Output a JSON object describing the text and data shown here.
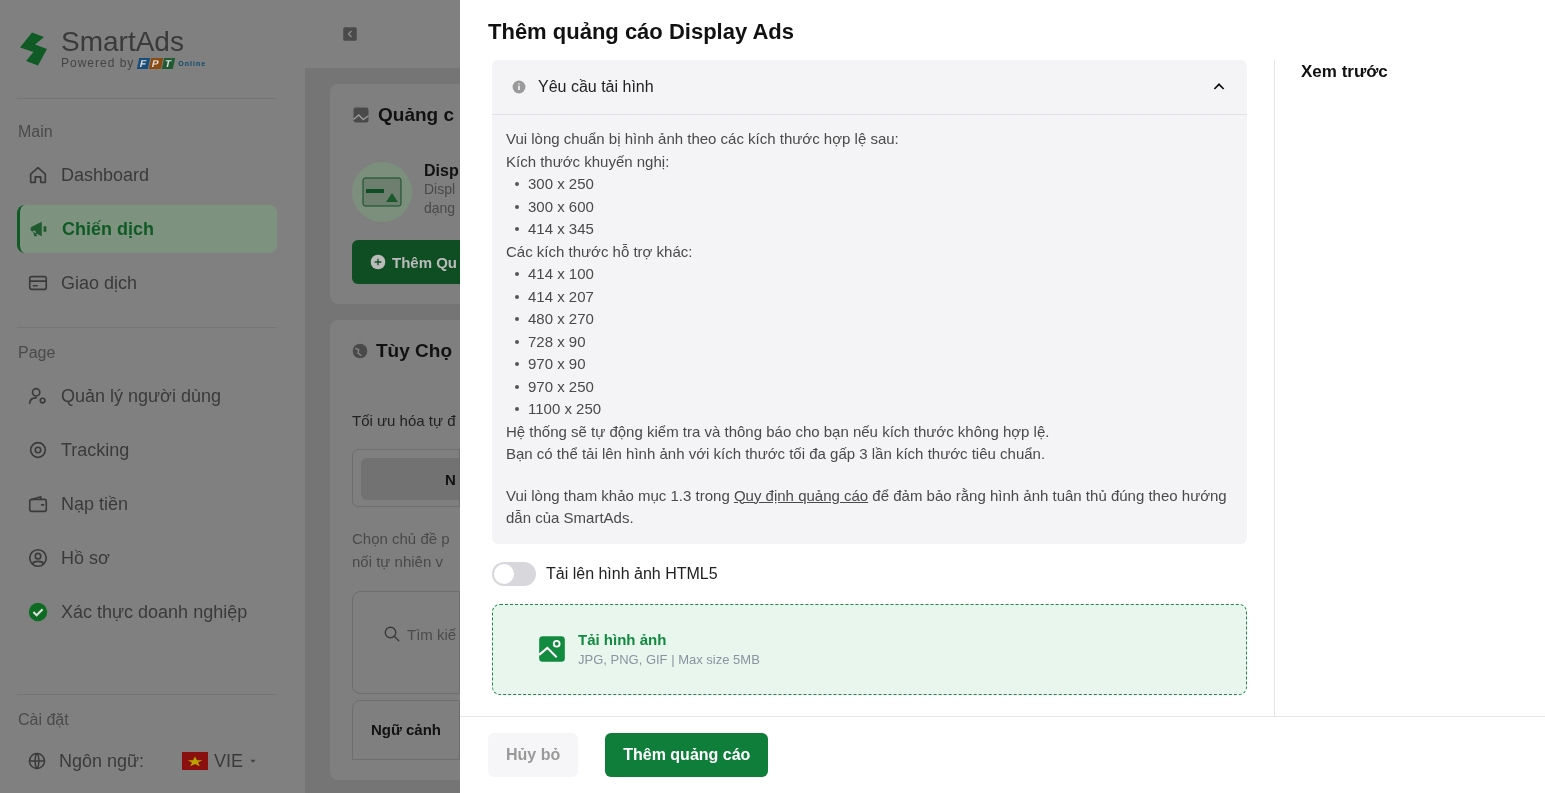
{
  "sidebar": {
    "brand": "SmartAds",
    "powered_by": "Powered by",
    "partner_letters": [
      "F",
      "P",
      "T"
    ],
    "partner_suffix": "Online",
    "sections": [
      {
        "label": "Main",
        "items": [
          {
            "label": "Dashboard",
            "selected": false
          },
          {
            "label": "Chiến dịch",
            "selected": true
          },
          {
            "label": "Giao dịch",
            "selected": false
          }
        ]
      },
      {
        "label": "Page",
        "items": [
          {
            "label": "Quản lý người dùng",
            "selected": false
          },
          {
            "label": "Tracking",
            "selected": false
          },
          {
            "label": "Nạp tiền",
            "selected": false
          },
          {
            "label": "Hồ sơ",
            "selected": false
          },
          {
            "label": "Xác thực doanh nghiệp",
            "selected": false
          }
        ]
      }
    ],
    "settings": {
      "label": "Cài đặt",
      "language_label": "Ngôn ngữ:",
      "language_value": "VIE"
    }
  },
  "main": {
    "ads_card": {
      "title": "Quảng c",
      "item_title": "Disp",
      "item_desc": [
        "Displ",
        "dạng"
      ],
      "add_button": "Thêm Qu"
    },
    "options_card": {
      "title": "Tùy Chọ",
      "subtitle": "Tối ưu hóa tự đ",
      "tab": "N",
      "desc": [
        "Chọn chủ đề p",
        "nối tự nhiên v"
      ],
      "search_placeholder": "Tìm kiế",
      "context_title": "Ngữ cảnh"
    }
  },
  "drawer": {
    "title": "Thêm quảng cáo Display Ads",
    "requirements": {
      "title": "Yêu cầu tải hình",
      "expanded": true,
      "intro": "Vui lòng chuẩn bị hình ảnh theo các kích thước hợp lệ sau:",
      "recommended_label": "Kích thước khuyến nghị:",
      "recommended": [
        "300 x 250",
        "300 x 600",
        "414 x 345"
      ],
      "other_label": "Các kích thước hỗ trợ khác:",
      "others": [
        "414 x 100",
        "414 x 207",
        "480 x 270",
        "728 x 90",
        "970 x 90",
        "970 x 250",
        "1100 x 250"
      ],
      "notes": [
        "Hệ thống sẽ tự động kiểm tra và thông báo cho bạn nếu kích thước không hợp lệ.",
        "Bạn có thể tải lên hình ảnh với kích thước tối đa gấp 3 lần kích thước tiêu chuẩn."
      ],
      "reference_before": "Vui lòng tham khảo mục 1.3 trong ",
      "reference_link": "Quy định quảng cáo",
      "reference_after": " để đảm bảo rằng hình ảnh tuân thủ đúng theo hướng dẫn của SmartAds."
    },
    "html5_toggle": {
      "label": "Tải lên hình ảnh HTML5",
      "on": false
    },
    "upload": {
      "title": "Tải hình ảnh",
      "hint": "JPG, PNG, GIF | Max size 5MB"
    },
    "preview_title": "Xem trước",
    "buttons": {
      "cancel": "Hủy bỏ",
      "submit": "Thêm quảng cáo"
    }
  }
}
